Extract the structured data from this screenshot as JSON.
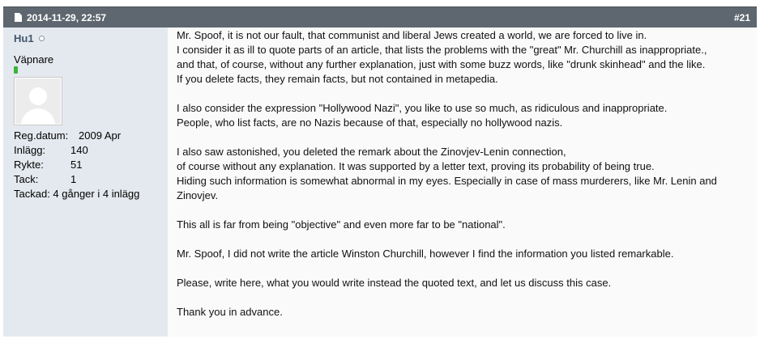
{
  "header": {
    "date": "2014-11-29, 22:57",
    "post_number": "#21"
  },
  "user": {
    "name": "Hu1",
    "rank": "Väpnare",
    "stats": [
      {
        "label": "Reg.datum:",
        "value": "2009 Apr"
      },
      {
        "label": "Inlägg:",
        "value": "140"
      },
      {
        "label": "Rykte:",
        "value": "51"
      },
      {
        "label": "Tack:",
        "value": "1"
      }
    ],
    "thanked": "Tackad: 4 gånger i 4 inlägg"
  },
  "message": {
    "paragraphs": [
      [
        "Mr. Spoof, it is not our fault, that communist and liberal Jews created a world, we are forced to live in.",
        "I consider it as ill to quote parts of an article, that lists the problems with the \"great\" Mr. Churchill as inappropriate.,",
        "and that, of course, without any further explanation, just with some buzz words, like \"drunk skinhead\" and the like.",
        "If you delete facts, they remain facts, but not contained in metapedia."
      ],
      [
        "I also consider the expression \"Hollywood Nazi\", you like to use so much, as ridiculous and inappropriate.",
        "People, who list facts, are no Nazis because of that, especially no hollywood nazis."
      ],
      [
        "I also saw astonished, you deleted the remark about the Zinovjev-Lenin connection,",
        "of course without any explanation. It was supported by a letter text, proving its probability of being true.",
        "Hiding such information is somewhat abnormal in my eyes. Especially in case of mass murderers, like Mr. Lenin and Zinovjev."
      ],
      [
        "This all is far from being \"objective\" and even more far to be \"national\"."
      ],
      [
        "Mr. Spoof, I did not write the article Winston Churchill, however I find the information you listed remarkable."
      ],
      [
        "Please, write here, what you would write instead the quoted text, and let us discuss this case."
      ],
      [
        "Thank you in advance."
      ]
    ]
  }
}
